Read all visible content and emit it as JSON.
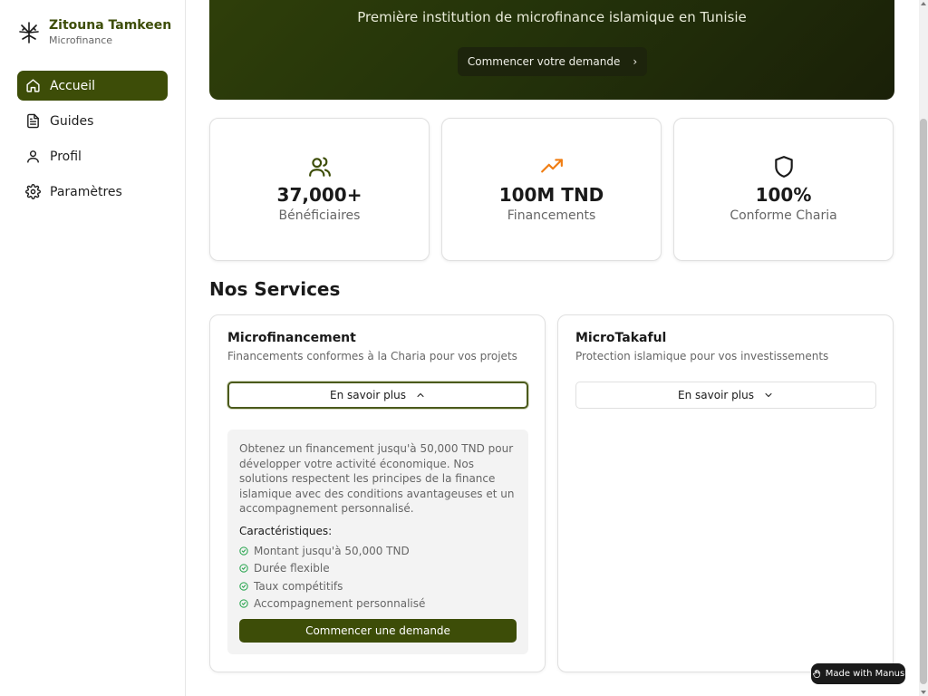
{
  "brand": {
    "name": "Zitouna Tamkeen",
    "subtitle": "Microfinance",
    "logo_icon": "tree-icon"
  },
  "sidebar": {
    "items": [
      {
        "label": "Accueil",
        "icon": "home-icon",
        "active": true
      },
      {
        "label": "Guides",
        "icon": "document-icon",
        "active": false
      },
      {
        "label": "Profil",
        "icon": "user-icon",
        "active": false
      },
      {
        "label": "Paramètres",
        "icon": "gear-icon",
        "active": false
      }
    ]
  },
  "hero": {
    "subtitle": "Première institution de microfinance islamique en Tunisie",
    "cta_label": "Commencer votre demande",
    "cta_icon": "chevron-right-icon"
  },
  "stats": [
    {
      "value": "37,000+",
      "label": "Bénéficiaires",
      "icon": "users-icon",
      "color": "#3d4d08"
    },
    {
      "value": "100M TND",
      "label": "Financements",
      "icon": "trending-up-icon",
      "color": "#f07d12"
    },
    {
      "value": "100%",
      "label": "Conforme Charia",
      "icon": "shield-icon",
      "color": "#1a1a1a"
    }
  ],
  "services": {
    "title": "Nos Services",
    "cards": [
      {
        "title": "Microfinancement",
        "description": "Financements conformes à la Charia pour vos projets",
        "more_label": "En savoir plus",
        "expanded": true,
        "details": "Obtenez un financement jusqu'à 50,000 TND pour développer votre activité économique. Nos solutions respectent les principes de la finance islamique avec des conditions avantageuses et un accompagnement personnalisé.",
        "features_title": "Caractéristiques:",
        "features": [
          "Montant jusqu'à 50,000 TND",
          "Durée flexible",
          "Taux compétitifs",
          "Accompagnement personnalisé"
        ],
        "cta_label": "Commencer une demande"
      },
      {
        "title": "MicroTakaful",
        "description": "Protection islamique pour vos investissements",
        "more_label": "En savoir plus",
        "expanded": false
      }
    ]
  },
  "badge": {
    "label": "Made with Manus"
  },
  "colors": {
    "primary": "#3d4d08",
    "success": "#22a34a",
    "accent": "#f07d12"
  }
}
